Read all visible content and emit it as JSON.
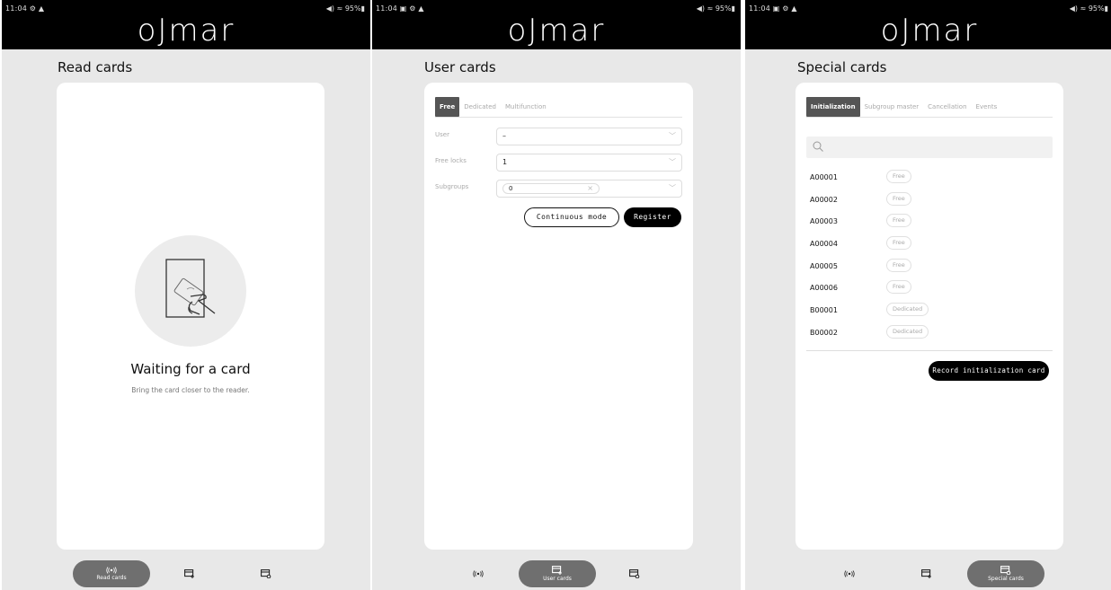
{
  "brand": "oJmar",
  "screens": [
    {
      "status": {
        "time": "11:04 ⚙ ▲",
        "right": "◀) ≈ 95%▮"
      },
      "title": "Read cards",
      "waiting_title": "Waiting for a card",
      "waiting_subtitle": "Bring the card closer to the reader.",
      "nav": [
        {
          "label": "Read cards",
          "icon": "nfc-icon",
          "active": true
        },
        {
          "label": "",
          "icon": "add-card-icon",
          "active": false
        },
        {
          "label": "",
          "icon": "card-settings-icon",
          "active": false
        }
      ]
    },
    {
      "status": {
        "time": "11:04 ▣ ⚙ ▲",
        "right": "◀) ≈ 95%▮"
      },
      "title": "User cards",
      "tabs": [
        "Free",
        "Dedicated",
        "Multifunction"
      ],
      "fields": {
        "user_label": "User",
        "user_value": "–",
        "locks_label": "Free locks",
        "locks_value": "1",
        "subgroups_label": "Subgroups",
        "subgroups_chip": "0"
      },
      "continuous_mode": "Continuous mode",
      "register": "Register",
      "nav": [
        {
          "label": "",
          "icon": "nfc-icon",
          "active": false
        },
        {
          "label": "User cards",
          "icon": "add-card-icon",
          "active": true
        },
        {
          "label": "",
          "icon": "card-settings-icon",
          "active": false
        }
      ]
    },
    {
      "status": {
        "time": "11:04 ▣ ⚙ ▲",
        "right": "◀) ≈ 95%▮"
      },
      "title": "Special cards",
      "tabs": [
        "Initialization",
        "Subgroup master",
        "Cancellation",
        "Events"
      ],
      "cards": [
        {
          "code": "A00001",
          "type": "Free"
        },
        {
          "code": "A00002",
          "type": "Free"
        },
        {
          "code": "A00003",
          "type": "Free"
        },
        {
          "code": "A00004",
          "type": "Free"
        },
        {
          "code": "A00005",
          "type": "Free"
        },
        {
          "code": "A00006",
          "type": "Free"
        },
        {
          "code": "B00001",
          "type": "Dedicated"
        },
        {
          "code": "B00002",
          "type": "Dedicated"
        }
      ],
      "record_button": "Record initialization card",
      "nav": [
        {
          "label": "",
          "icon": "nfc-icon",
          "active": false
        },
        {
          "label": "",
          "icon": "add-card-icon",
          "active": false
        },
        {
          "label": "Special cards",
          "icon": "card-settings-icon",
          "active": true
        }
      ]
    }
  ],
  "colors": {
    "topbar": "#000000",
    "background": "#e8e8e8",
    "card": "#ffffff",
    "active_tab": "#555555",
    "nav_active": "#6f6f6f"
  }
}
